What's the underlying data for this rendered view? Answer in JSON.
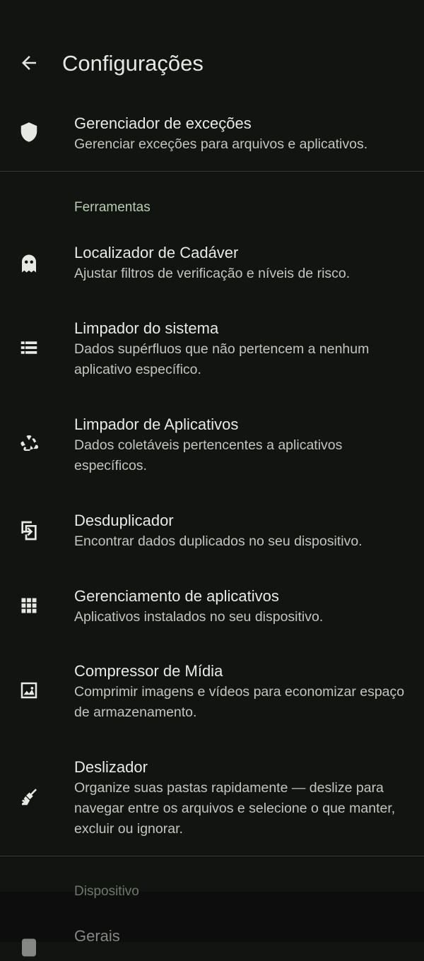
{
  "header": {
    "title": "Configurações"
  },
  "exceptions": {
    "title": "Gerenciador de exceções",
    "subtitle": "Gerenciar exceções para arquivos e aplicativos."
  },
  "tools_section": {
    "label": "Ferramentas",
    "items": [
      {
        "icon": "ghost-icon",
        "title": "Localizador de Cadáver",
        "subtitle": "Ajustar filtros de verificação e níveis de risco."
      },
      {
        "icon": "list-icon",
        "title": "Limpador do sistema",
        "subtitle": "Dados supérfluos que não pertencem a nenhum aplicativo específico."
      },
      {
        "icon": "recycle-icon",
        "title": "Limpador de Aplicativos",
        "subtitle": "Dados coletáveis pertencentes a aplicativos específicos."
      },
      {
        "icon": "duplicate-icon",
        "title": "Desduplicador",
        "subtitle": "Encontrar dados duplicados no seu dispositivo."
      },
      {
        "icon": "apps-grid-icon",
        "title": "Gerenciamento de aplicativos",
        "subtitle": "Aplicativos instalados no seu dispositivo."
      },
      {
        "icon": "image-icon",
        "title": "Compressor de Mídia",
        "subtitle": "Comprimir imagens e vídeos para economizar espaço de armazenamento."
      },
      {
        "icon": "broom-icon",
        "title": "Deslizador",
        "subtitle": "Organize suas pastas rapidamente — deslize para navegar entre os arquivos e selecione o que manter, excluir ou ignorar."
      }
    ]
  },
  "device_section": {
    "label": "Dispositivo",
    "items": [
      {
        "icon": "device-icon",
        "title": "Gerais"
      }
    ]
  },
  "colors": {
    "background": "#121412",
    "text_primary": "#e8eae5",
    "text_secondary": "#c2c6bf",
    "section_accent": "#b8ccb2",
    "divider": "#353833"
  }
}
